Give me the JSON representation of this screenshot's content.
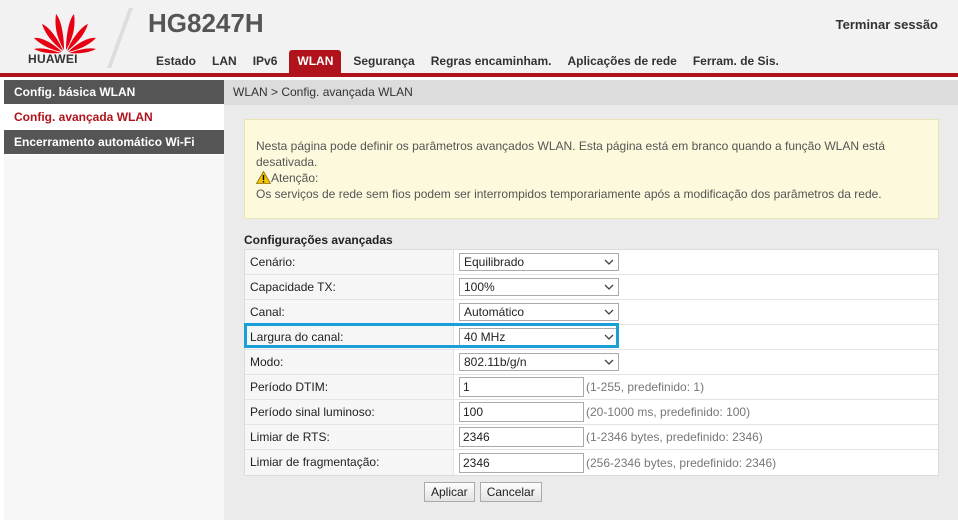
{
  "header": {
    "brand": "HUAWEI",
    "model": "HG8247H",
    "logout_label": "Terminar sessão",
    "accent_color": "#b0131b"
  },
  "nav": {
    "items": [
      {
        "label": "Estado"
      },
      {
        "label": "LAN"
      },
      {
        "label": "IPv6"
      },
      {
        "label": "WLAN",
        "active": true
      },
      {
        "label": "Segurança"
      },
      {
        "label": "Regras encaminham."
      },
      {
        "label": "Aplicações de rede"
      },
      {
        "label": "Ferram. de Sis."
      }
    ]
  },
  "sidebar": {
    "items": [
      {
        "label": "Config. básica WLAN"
      },
      {
        "label": "Config. avançada WLAN",
        "active": true
      },
      {
        "label": "Encerramento automático Wi-Fi"
      }
    ]
  },
  "breadcrumb": "WLAN > Config. avançada WLAN",
  "info": {
    "text": "Nesta página pode definir os parâmetros avançados WLAN. Esta página está em branco quando a função WLAN está desativada.",
    "warning_label": "Atenção:",
    "warning_text": "Os serviços de rede sem fios podem ser interrompidos temporariamente após a modificação dos parâmetros da rede.",
    "warning_icon": "warning-triangle-icon"
  },
  "section_title": "Configurações avançadas",
  "form": {
    "scenario": {
      "label": "Cenário:",
      "value": "Equilibrado"
    },
    "tx_capacity": {
      "label": "Capacidade TX:",
      "value": "100%"
    },
    "channel": {
      "label": "Canal:",
      "value": "Automático"
    },
    "channel_width": {
      "label": "Largura do canal:",
      "value": "40 MHz"
    },
    "mode": {
      "label": "Modo:",
      "value": "802.11b/g/n"
    },
    "dtim": {
      "label": "Período DTIM:",
      "value": "1",
      "hint": "(1-255, predefinido: 1)"
    },
    "beacon": {
      "label": "Período sinal luminoso:",
      "value": "100",
      "hint": "(20-1000 ms, predefinido: 100)"
    },
    "rts": {
      "label": "Limiar de RTS:",
      "value": "2346",
      "hint": "(1-2346 bytes, predefinido: 2346)"
    },
    "frag": {
      "label": "Limiar de fragmentação:",
      "value": "2346",
      "hint": "(256-2346 bytes, predefinido: 2346)"
    }
  },
  "buttons": {
    "apply": "Aplicar",
    "cancel": "Cancelar"
  },
  "highlight_color": "#1a9fd6"
}
